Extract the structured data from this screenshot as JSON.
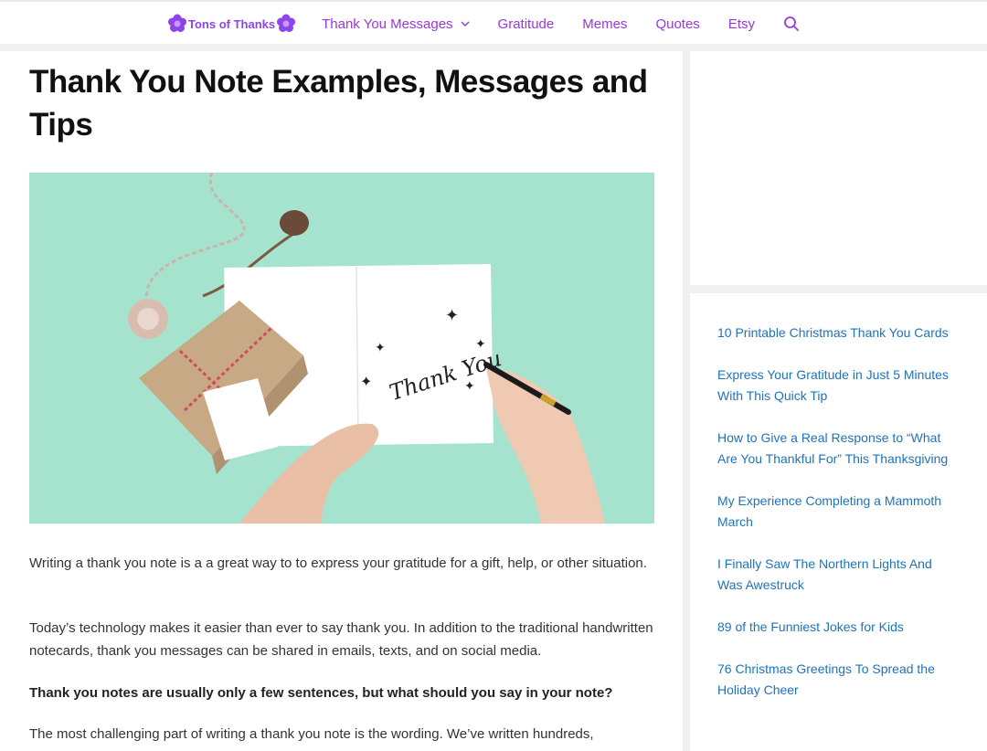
{
  "header": {
    "logo_text": "Tons of Thanks",
    "nav": [
      {
        "label": "Thank You Messages",
        "has_dropdown": true
      },
      {
        "label": "Gratitude"
      },
      {
        "label": "Memes"
      },
      {
        "label": "Quotes"
      },
      {
        "label": "Etsy"
      }
    ],
    "search_icon": "search-icon"
  },
  "article": {
    "title": "Thank You Note Examples, Messages and Tips",
    "hero_card_text": "Thank You",
    "paragraphs": [
      "Writing a thank you note is a a great way to to express your gratitude for a gift, help, or other situation.",
      "Today’s technology makes it easier than ever to say thank you. In addition to the traditional handwritten notecards, thank you messages can be shared in emails, texts, and on social media.",
      "Thank you notes are usually only a few sentences, but what should you say in your note?",
      "The most challenging part of writing a thank you note is the wording. We’ve written hundreds,"
    ]
  },
  "sidebar": {
    "recent_posts": [
      "10 Printable Christmas Thank You Cards",
      "Express Your Gratitude in Just 5 Minutes With This Quick Tip",
      "How to Give a Real Response to “What Are You Thankful For” This Thanksgiving",
      "My Experience Completing a Mammoth March",
      "I Finally Saw The Northern Lights And Was Awestruck",
      "89 of the Funniest Jokes for Kids",
      "76 Christmas Greetings To Spread the Holiday Cheer"
    ]
  },
  "colors": {
    "brand": "#9b35e6",
    "link": "#1e73be",
    "hero_bg": "#a6e3cf"
  }
}
